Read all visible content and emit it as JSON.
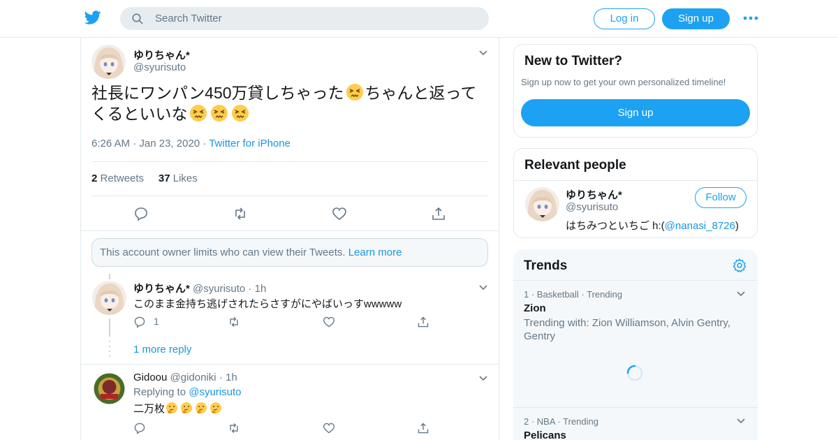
{
  "header": {
    "search_placeholder": "Search Twitter",
    "login_label": "Log in",
    "signup_label": "Sign up",
    "logo_icon": "twitter-bird-icon",
    "more_icon": "more-dots-icon"
  },
  "tweet": {
    "author_name": "ゆりちゃん*",
    "author_handle": "@syurisuto",
    "text_part1": "社長にワンパン450万貸しちゃった",
    "text_part2": "ちゃんと返ってくるといいな",
    "emoji": "persevering-face-emoji",
    "time": "6:26 AM",
    "date": "Jan 23, 2020",
    "source": "Twitter for iPhone",
    "retweets_count": "2",
    "retweets_label": "Retweets",
    "likes_count": "37",
    "likes_label": "Likes"
  },
  "notice": {
    "text": "This account owner limits who can view their Tweets.",
    "link": "Learn more"
  },
  "replies": [
    {
      "name": "ゆりちゃん*",
      "handle": "@syurisuto",
      "time": "1h",
      "text": "このまま金持ち逃げされたらさすがにやばいっすwwwww",
      "reply_count": "1",
      "more_replies": "1 more reply"
    },
    {
      "name": "Gidoou",
      "handle": "@gidoniki",
      "time": "1h",
      "replying_to_label": "Replying to",
      "replying_to_handle": "@syurisuto",
      "text": "二万枚",
      "emoji": "thinking-face-emoji"
    }
  ],
  "sidebar": {
    "new_to_twitter": {
      "title": "New to Twitter?",
      "subtitle": "Sign up now to get your own personalized timeline!",
      "button": "Sign up"
    },
    "relevant_people": {
      "title": "Relevant people",
      "name": "ゆりちゃん*",
      "handle": "@syurisuto",
      "bio_text": "はちみつといちご h:(",
      "bio_link": "@nanasi_8726",
      "bio_end": ")",
      "follow_label": "Follow"
    },
    "trends": {
      "title": "Trends",
      "items": [
        {
          "rank": "1",
          "category": "Basketball",
          "status": "Trending",
          "name": "Zion",
          "trending_with": "Trending with: Zion Williamson, Alvin Gentry, Gentry"
        },
        {
          "rank": "2",
          "category": "NBA",
          "status": "Trending",
          "name": "Pelicans"
        }
      ]
    }
  },
  "colors": {
    "brand_blue": "#1da1f2",
    "link_blue": "#1b95e0",
    "muted_text": "#657786",
    "border": "#e1e8ed"
  }
}
